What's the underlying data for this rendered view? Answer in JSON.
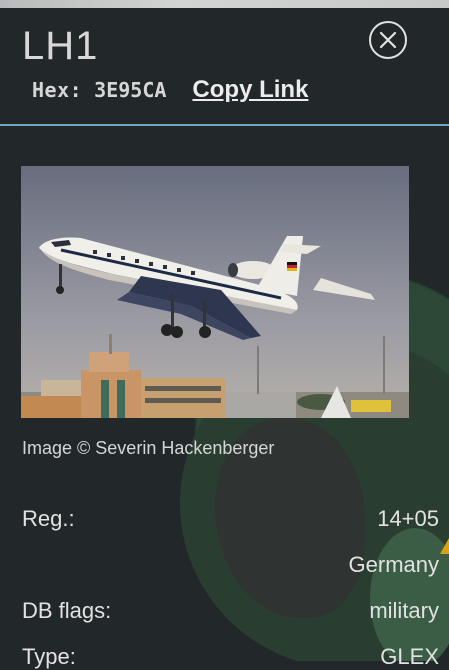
{
  "header": {
    "callsign": "LH1",
    "hex_label": "Hex:",
    "hex_value": "3E95CA",
    "copy_link_label": "Copy Link"
  },
  "photo": {
    "caption": "Image © Severin Hackenberger"
  },
  "details": [
    {
      "label": "Reg.:",
      "value": "14+05"
    },
    {
      "label": "",
      "value": "Germany"
    },
    {
      "label": "DB flags:",
      "value": "military"
    },
    {
      "label": "Type:",
      "value": "GLEX"
    }
  ],
  "colors": {
    "background": "#22272a",
    "divider": "#6ea8c4",
    "map_green": "#2c4a36",
    "accent": "#d5a21a"
  }
}
